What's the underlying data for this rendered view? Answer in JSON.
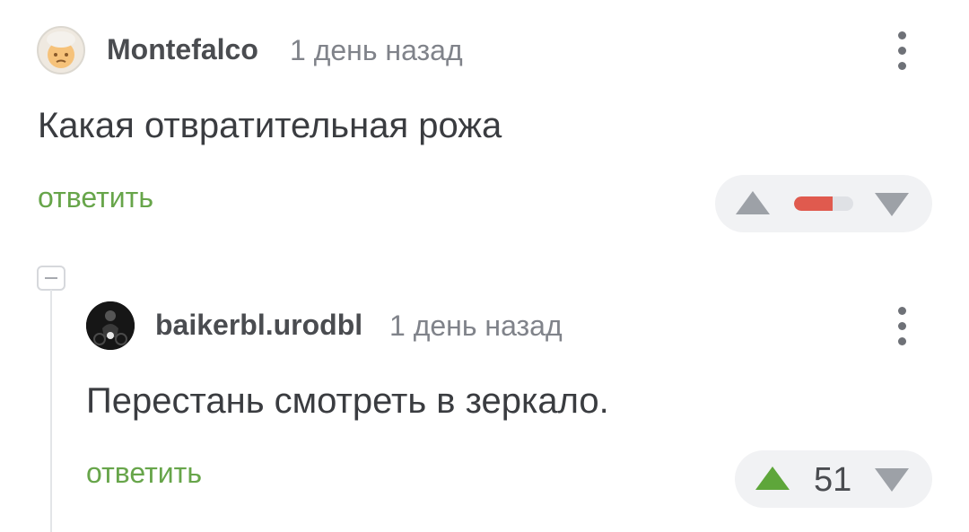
{
  "comments": [
    {
      "author": "Montefalco",
      "time": "1 день назад",
      "text": "Какая отвратительная рожа",
      "reply_label": "ответить",
      "rating": {
        "type": "bar",
        "positive_fraction": 0.65,
        "bar_color": "#e05a4e"
      }
    },
    {
      "author": "baikerbl.urodbl",
      "time": "1 день назад",
      "text": "Перестань смотреть в зеркало.",
      "reply_label": "ответить",
      "rating": {
        "type": "score",
        "value": "51",
        "upvoted": true
      }
    }
  ],
  "icons": {
    "more": "more-vertical-icon",
    "upvote": "upvote-triangle-icon",
    "downvote": "downvote-triangle-icon",
    "collapse": "collapse-minus-icon"
  },
  "colors": {
    "reply_green": "#67a54a",
    "upvote_active": "#5ea63a",
    "rating_bar_red": "#e05a4e",
    "muted_gray": "#9da1a7"
  }
}
